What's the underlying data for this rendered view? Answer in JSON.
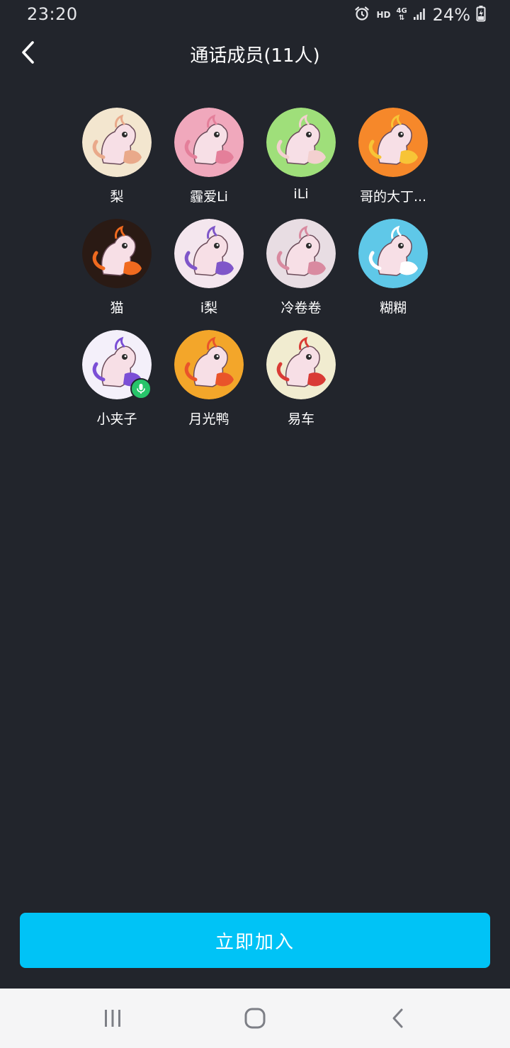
{
  "status_bar": {
    "time": "23:20",
    "hd": "HD",
    "network": "4G",
    "battery": "24%",
    "icons": [
      "alarm-icon",
      "signal-icon",
      "battery-icon"
    ]
  },
  "header": {
    "title": "通话成员(11人)",
    "back_icon": "chevron-left-icon"
  },
  "members": [
    {
      "name": "梨",
      "bg": "#f3e6cf",
      "accent": "#e9a98a",
      "mic": false
    },
    {
      "name": "霾爱Li",
      "bg": "#f0a8bc",
      "accent": "#e47f9a",
      "mic": false
    },
    {
      "name": "iLi",
      "bg": "#9fdf7a",
      "accent": "#f3d0cf",
      "mic": false
    },
    {
      "name": "哥的大丁...",
      "bg": "#f6882a",
      "accent": "#f7c437",
      "mic": false
    },
    {
      "name": "猫",
      "bg": "#2a1a14",
      "accent": "#f06a1f",
      "mic": false
    },
    {
      "name": "i梨",
      "bg": "#f4e6ee",
      "accent": "#7f56c9",
      "mic": false
    },
    {
      "name": "冷卷卷",
      "bg": "#e8dde3",
      "accent": "#d98aa0",
      "mic": false
    },
    {
      "name": "糊糊",
      "bg": "#5fc8e8",
      "accent": "#ffffff",
      "mic": false
    },
    {
      "name": "小夹子",
      "bg": "#f4f0fa",
      "accent": "#7b4fd6",
      "mic": true
    },
    {
      "name": "月光鸭",
      "bg": "#f3a62a",
      "accent": "#e9542a",
      "mic": false
    },
    {
      "name": "易车",
      "bg": "#f1ecd0",
      "accent": "#d93b35",
      "mic": false
    }
  ],
  "join_button": {
    "label": "立即加入",
    "color": "#00c3f6"
  },
  "nav_bar": {
    "icons": [
      "recent-apps-icon",
      "home-icon",
      "back-icon"
    ]
  }
}
